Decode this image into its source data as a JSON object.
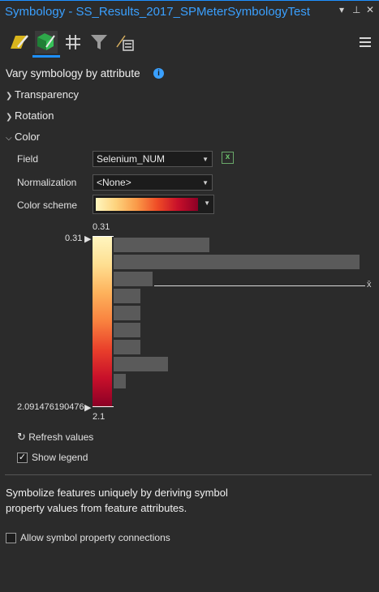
{
  "window": {
    "title": "Symbology - SS_Results_2017_SPMeterSymbologyTest",
    "controls": {
      "dropdown": "▾",
      "pin": "⊥",
      "close": "✕"
    }
  },
  "toolbar": {
    "tabs": [
      {
        "icon": "primary-symbology-icon",
        "active": false
      },
      {
        "icon": "vary-symbology-icon",
        "active": true
      },
      {
        "icon": "symbol-layers-icon",
        "active": false
      },
      {
        "icon": "filter-icon",
        "active": false
      },
      {
        "icon": "symbol-props-icon",
        "active": false
      }
    ],
    "menu_icon": "hamburger-menu-icon"
  },
  "section": {
    "title": "Vary symbology by attribute",
    "info_icon": "info-icon"
  },
  "groups": {
    "transparency": "Transparency",
    "rotation": "Rotation",
    "color": "Color"
  },
  "color": {
    "field_label": "Field",
    "field_value": "Selenium_NUM",
    "normalization_label": "Normalization",
    "normalization_value": "<None>",
    "color_scheme_label": "Color scheme"
  },
  "histogram": {
    "top_value": "0.31",
    "top_marker_label": "0.31",
    "bottom_marker_label": "2.091476190476",
    "bottom_value": "2.1",
    "stat_line_label": "x̄",
    "bars": [
      0.39,
      1.0,
      0.16,
      0.11,
      0.11,
      0.11,
      0.11,
      0.22,
      0.05
    ]
  },
  "options": {
    "refresh_label": "Refresh values",
    "show_legend_label": "Show legend",
    "show_legend_checked": true,
    "allow_connections_label": "Allow symbol property connections",
    "allow_connections_checked": false
  },
  "description": "Symbolize features uniquely by deriving symbol property values from feature attributes.",
  "colors": {
    "accent": "#1e90ff",
    "title": "#3aa0ff",
    "bar": "#5a5a5a"
  }
}
